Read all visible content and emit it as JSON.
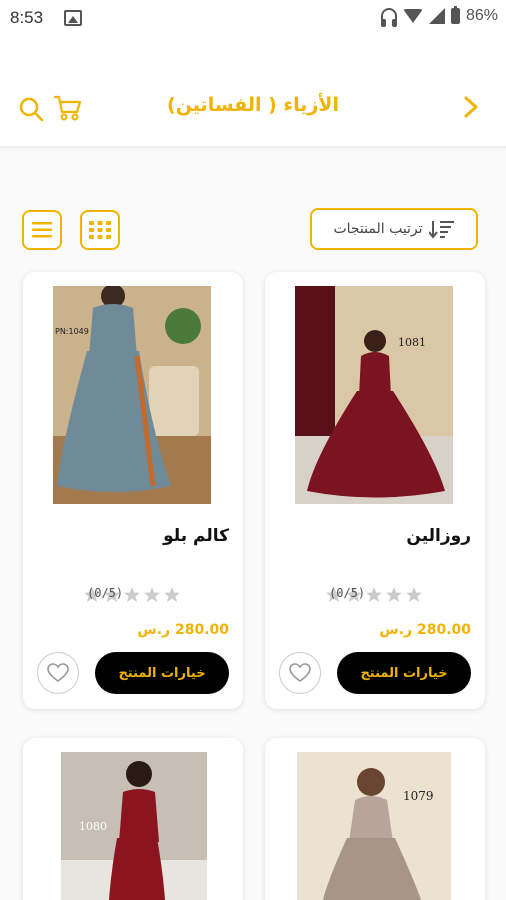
{
  "status_bar": {
    "time": "8:53",
    "battery_percent": "86%"
  },
  "header": {
    "title": "الأزياء ( الفساتين)",
    "accent_color": "#f0b400"
  },
  "toolbar": {
    "sort_label": "ترتيب المنتجات"
  },
  "products": [
    {
      "name": "روزالين",
      "price": "280.00 ر.س",
      "rating_count": "(0/5)",
      "options_label": "خيارات المنتج",
      "badge": "1081",
      "image_bg": "#7b1420"
    },
    {
      "name": "كالم بلو",
      "price": "280.00 ر.س",
      "rating_count": "(0/5)",
      "options_label": "خيارات المنتج",
      "badge": "PN:1049",
      "image_bg": "#6f8a98"
    },
    {
      "badge": "1079",
      "image_bg": "#a89488"
    },
    {
      "badge": "1080",
      "image_bg": "#8a1520"
    }
  ]
}
